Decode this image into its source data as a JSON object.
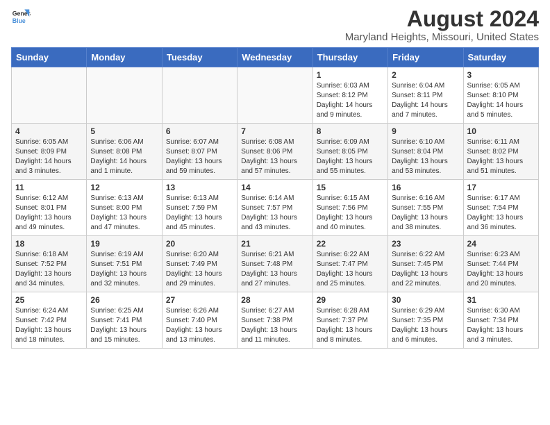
{
  "logo": {
    "general": "General",
    "blue": "Blue"
  },
  "header": {
    "title": "August 2024",
    "subtitle": "Maryland Heights, Missouri, United States"
  },
  "weekdays": [
    "Sunday",
    "Monday",
    "Tuesday",
    "Wednesday",
    "Thursday",
    "Friday",
    "Saturday"
  ],
  "weeks": [
    [
      {
        "day": "",
        "info": ""
      },
      {
        "day": "",
        "info": ""
      },
      {
        "day": "",
        "info": ""
      },
      {
        "day": "",
        "info": ""
      },
      {
        "day": "1",
        "info": "Sunrise: 6:03 AM\nSunset: 8:12 PM\nDaylight: 14 hours\nand 9 minutes."
      },
      {
        "day": "2",
        "info": "Sunrise: 6:04 AM\nSunset: 8:11 PM\nDaylight: 14 hours\nand 7 minutes."
      },
      {
        "day": "3",
        "info": "Sunrise: 6:05 AM\nSunset: 8:10 PM\nDaylight: 14 hours\nand 5 minutes."
      }
    ],
    [
      {
        "day": "4",
        "info": "Sunrise: 6:05 AM\nSunset: 8:09 PM\nDaylight: 14 hours\nand 3 minutes."
      },
      {
        "day": "5",
        "info": "Sunrise: 6:06 AM\nSunset: 8:08 PM\nDaylight: 14 hours\nand 1 minute."
      },
      {
        "day": "6",
        "info": "Sunrise: 6:07 AM\nSunset: 8:07 PM\nDaylight: 13 hours\nand 59 minutes."
      },
      {
        "day": "7",
        "info": "Sunrise: 6:08 AM\nSunset: 8:06 PM\nDaylight: 13 hours\nand 57 minutes."
      },
      {
        "day": "8",
        "info": "Sunrise: 6:09 AM\nSunset: 8:05 PM\nDaylight: 13 hours\nand 55 minutes."
      },
      {
        "day": "9",
        "info": "Sunrise: 6:10 AM\nSunset: 8:04 PM\nDaylight: 13 hours\nand 53 minutes."
      },
      {
        "day": "10",
        "info": "Sunrise: 6:11 AM\nSunset: 8:02 PM\nDaylight: 13 hours\nand 51 minutes."
      }
    ],
    [
      {
        "day": "11",
        "info": "Sunrise: 6:12 AM\nSunset: 8:01 PM\nDaylight: 13 hours\nand 49 minutes."
      },
      {
        "day": "12",
        "info": "Sunrise: 6:13 AM\nSunset: 8:00 PM\nDaylight: 13 hours\nand 47 minutes."
      },
      {
        "day": "13",
        "info": "Sunrise: 6:13 AM\nSunset: 7:59 PM\nDaylight: 13 hours\nand 45 minutes."
      },
      {
        "day": "14",
        "info": "Sunrise: 6:14 AM\nSunset: 7:57 PM\nDaylight: 13 hours\nand 43 minutes."
      },
      {
        "day": "15",
        "info": "Sunrise: 6:15 AM\nSunset: 7:56 PM\nDaylight: 13 hours\nand 40 minutes."
      },
      {
        "day": "16",
        "info": "Sunrise: 6:16 AM\nSunset: 7:55 PM\nDaylight: 13 hours\nand 38 minutes."
      },
      {
        "day": "17",
        "info": "Sunrise: 6:17 AM\nSunset: 7:54 PM\nDaylight: 13 hours\nand 36 minutes."
      }
    ],
    [
      {
        "day": "18",
        "info": "Sunrise: 6:18 AM\nSunset: 7:52 PM\nDaylight: 13 hours\nand 34 minutes."
      },
      {
        "day": "19",
        "info": "Sunrise: 6:19 AM\nSunset: 7:51 PM\nDaylight: 13 hours\nand 32 minutes."
      },
      {
        "day": "20",
        "info": "Sunrise: 6:20 AM\nSunset: 7:49 PM\nDaylight: 13 hours\nand 29 minutes."
      },
      {
        "day": "21",
        "info": "Sunrise: 6:21 AM\nSunset: 7:48 PM\nDaylight: 13 hours\nand 27 minutes."
      },
      {
        "day": "22",
        "info": "Sunrise: 6:22 AM\nSunset: 7:47 PM\nDaylight: 13 hours\nand 25 minutes."
      },
      {
        "day": "23",
        "info": "Sunrise: 6:22 AM\nSunset: 7:45 PM\nDaylight: 13 hours\nand 22 minutes."
      },
      {
        "day": "24",
        "info": "Sunrise: 6:23 AM\nSunset: 7:44 PM\nDaylight: 13 hours\nand 20 minutes."
      }
    ],
    [
      {
        "day": "25",
        "info": "Sunrise: 6:24 AM\nSunset: 7:42 PM\nDaylight: 13 hours\nand 18 minutes."
      },
      {
        "day": "26",
        "info": "Sunrise: 6:25 AM\nSunset: 7:41 PM\nDaylight: 13 hours\nand 15 minutes."
      },
      {
        "day": "27",
        "info": "Sunrise: 6:26 AM\nSunset: 7:40 PM\nDaylight: 13 hours\nand 13 minutes."
      },
      {
        "day": "28",
        "info": "Sunrise: 6:27 AM\nSunset: 7:38 PM\nDaylight: 13 hours\nand 11 minutes."
      },
      {
        "day": "29",
        "info": "Sunrise: 6:28 AM\nSunset: 7:37 PM\nDaylight: 13 hours\nand 8 minutes."
      },
      {
        "day": "30",
        "info": "Sunrise: 6:29 AM\nSunset: 7:35 PM\nDaylight: 13 hours\nand 6 minutes."
      },
      {
        "day": "31",
        "info": "Sunrise: 6:30 AM\nSunset: 7:34 PM\nDaylight: 13 hours\nand 3 minutes."
      }
    ]
  ]
}
